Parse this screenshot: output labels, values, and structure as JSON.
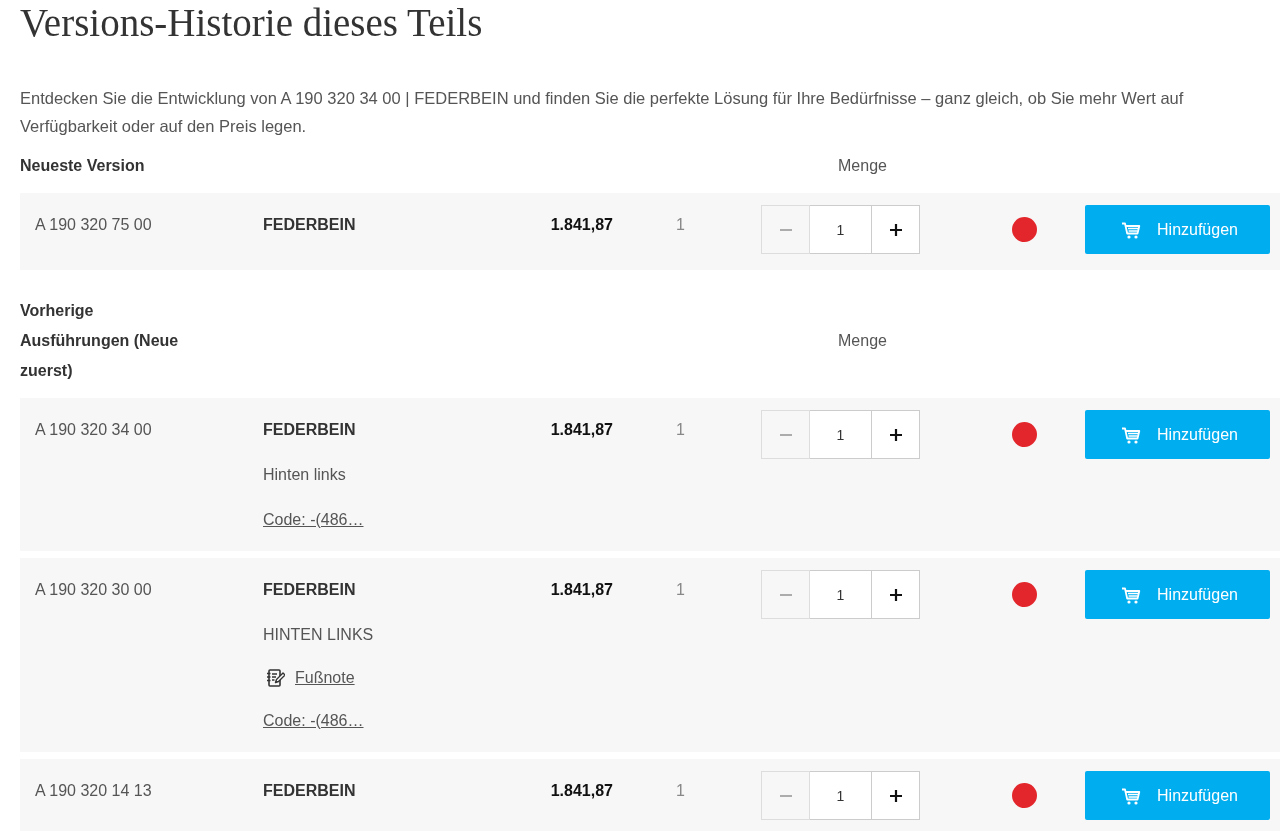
{
  "title": "Versions-Historie dieses Teils",
  "intro": "Entdecken Sie die Entwicklung von A 190 320 34 00 | FEDERBEIN und finden Sie die perfekte Lösung für Ihre Bedürfnisse – ganz gleich, ob Sie mehr Wert auf Verfügbarkeit oder auf den Preis legen.",
  "sections": [
    {
      "heading": "Neueste Version",
      "quantity_label": "Menge",
      "rows": [
        {
          "part_number": "A 190 320 75 00",
          "name": "FEDERBEIN",
          "details": [],
          "price": "1.841,87",
          "column_4": "1",
          "quantity": {
            "value": "1",
            "minus_disabled": true
          },
          "color": "#e3262b",
          "add_button": "Hinzufügen"
        }
      ]
    },
    {
      "heading": "Vorherige Ausführungen (Neue zuerst)",
      "quantity_label": "Menge",
      "rows": [
        {
          "part_number": "A 190 320 34 00",
          "name": "FEDERBEIN",
          "details": [
            {
              "kind": "text",
              "text": "Hinten links"
            },
            {
              "kind": "code",
              "text": "Code: -(486…"
            }
          ],
          "price": "1.841,87",
          "column_4": "1",
          "quantity": {
            "value": "1",
            "minus_disabled": true
          },
          "color": "#e3262b",
          "add_button": "Hinzufügen"
        },
        {
          "part_number": "A 190 320 30 00",
          "name": "FEDERBEIN",
          "details": [
            {
              "kind": "text",
              "text": "HINTEN LINKS"
            },
            {
              "kind": "footnote",
              "text": "Fußnote"
            },
            {
              "kind": "code",
              "text": "Code: -(486…"
            }
          ],
          "price": "1.841,87",
          "column_4": "1",
          "quantity": {
            "value": "1",
            "minus_disabled": true
          },
          "color": "#e3262b",
          "add_button": "Hinzufügen"
        },
        {
          "part_number": "A 190 320 14 13",
          "name": "FEDERBEIN",
          "details": [],
          "price": "1.841,87",
          "column_4": "1",
          "quantity": {
            "value": "1",
            "minus_disabled": true
          },
          "color": "#e3262b",
          "add_button": "Hinzufügen"
        }
      ]
    }
  ]
}
